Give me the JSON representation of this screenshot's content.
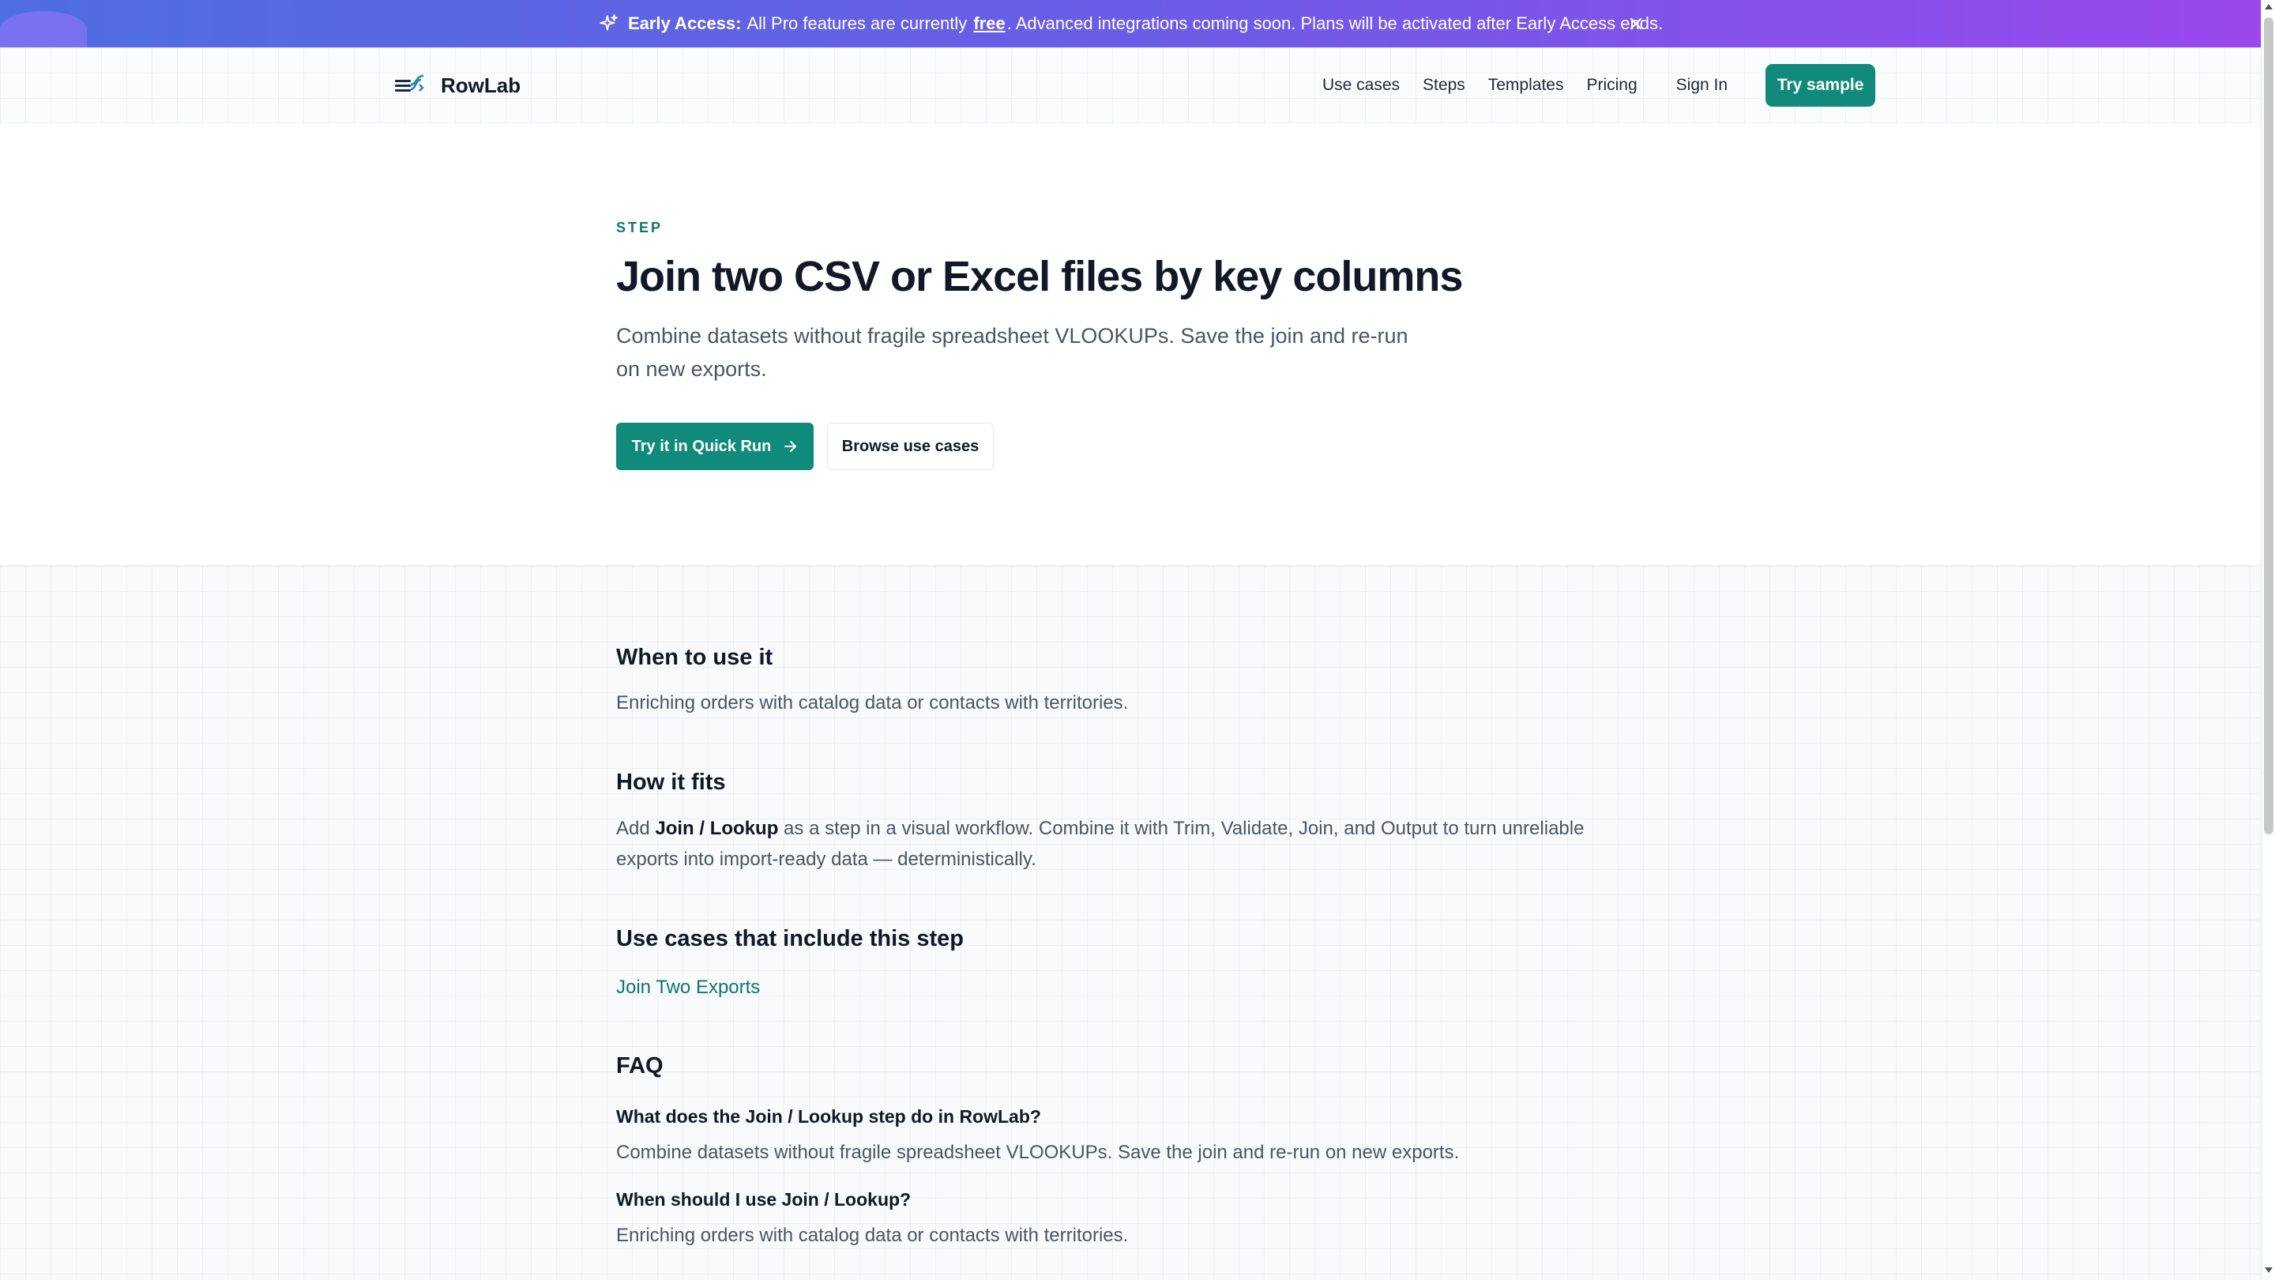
{
  "banner": {
    "lead": "Early Access:",
    "text_before": "All Pro features are currently",
    "free_word": "free",
    "text_after": ". Advanced integrations coming soon. Plans will be activated after Early Access ends.",
    "icon": "sparkle-icon",
    "close_icon": "close-icon"
  },
  "header": {
    "brand": "RowLab",
    "nav": [
      "Use cases",
      "Steps",
      "Templates",
      "Pricing"
    ],
    "sign_in": "Sign In",
    "try_sample": "Try sample"
  },
  "hero": {
    "eyebrow": "STEP",
    "title": "Join two CSV or Excel files by key columns",
    "subtitle": "Combine datasets without fragile spreadsheet VLOOKUPs. Save the join and re-run on new exports.",
    "primary_cta": "Try it in Quick Run",
    "secondary_cta": "Browse use cases"
  },
  "sections": {
    "when_title": "When to use it",
    "when_text": "Enriching orders with catalog data or contacts with territories.",
    "fits_title": "How it fits",
    "fits_before": "Add",
    "fits_step": "Join / Lookup",
    "fits_after": "as a step in a visual workflow. Combine it with Trim, Validate, Join, and Output to turn unreliable exports into import-ready data — deterministically.",
    "usecases_title": "Use cases that include this step",
    "usecase_link": "Join Two Exports",
    "faq_title": "FAQ",
    "faq": [
      {
        "q": "What does the Join / Lookup step do in RowLab?",
        "a": "Combine datasets without fragile spreadsheet VLOOKUPs. Save the join and re-run on new exports."
      },
      {
        "q": "When should I use Join / Lookup?",
        "a": "Enriching orders with catalog data or contacts with territories."
      }
    ]
  },
  "colors": {
    "accent": "#108a7a",
    "banner_start": "#4f6ee0",
    "banner_end": "#9a48ee"
  }
}
